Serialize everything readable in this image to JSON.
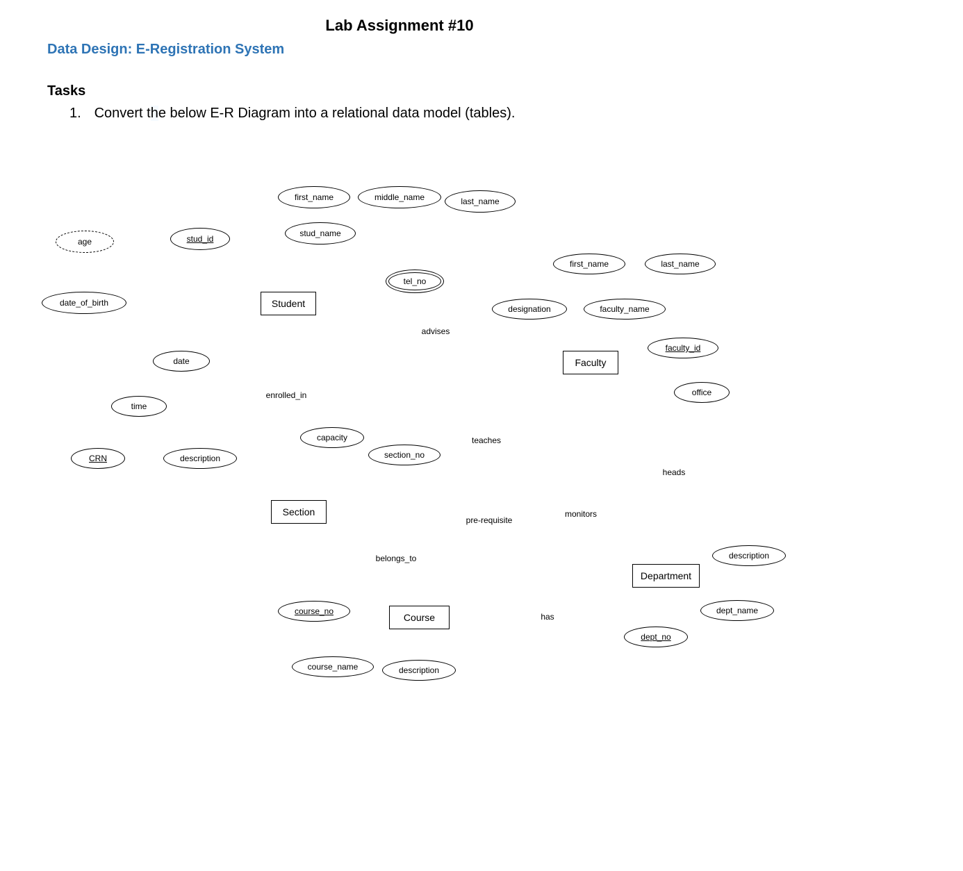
{
  "header": {
    "title": "Lab Assignment #10",
    "subtitle": "Data Design: E-Registration System"
  },
  "tasks": {
    "heading": "Tasks",
    "item_number": "1.",
    "item_text_a": "Convert t",
    "item_text_highlight": "h",
    "item_text_b": "e below E-R Diagram into a relational data model (tables)."
  },
  "erd": {
    "entities": {
      "student": "Student",
      "section": "Section",
      "course": "Course",
      "faculty": "Faculty",
      "department": "Department"
    },
    "relationships": {
      "advises": "advises",
      "enrolled_in": "enrolled_in",
      "teaches": "teaches",
      "belongs_to": "belongs_to",
      "prerequisite": "pre-requisite",
      "monitors": "monitors",
      "has": "has",
      "heads": "heads"
    },
    "attributes": {
      "age": "age",
      "date_of_birth": "date_of_birth",
      "stud_id": "stud_id",
      "stud_name": "stud_name",
      "first_name": "first_name",
      "middle_name": "middle_name",
      "last_name": "last_name",
      "tel_no": "tel_no",
      "date": "date",
      "time": "time",
      "crn": "CRN",
      "description": "description",
      "capacity": "capacity",
      "section_no": "section_no",
      "course_no": "course_no",
      "course_name": "course_name",
      "designation": "designation",
      "faculty_name": "faculty_name",
      "faculty_id": "faculty_id",
      "office": "office",
      "dept_no": "dept_no",
      "dept_name": "dept_name"
    }
  }
}
